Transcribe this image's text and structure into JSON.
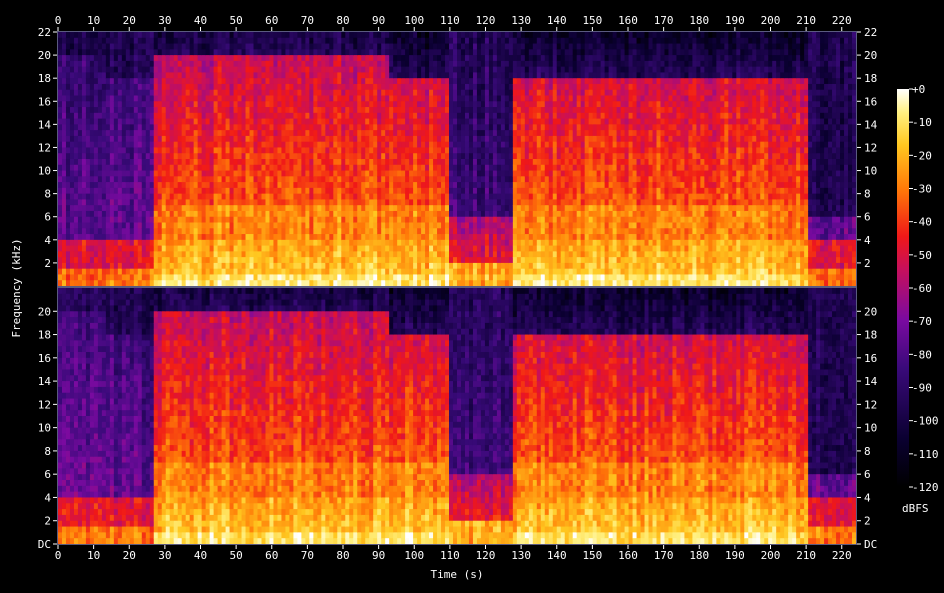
{
  "chart_data": {
    "type": "heatmap",
    "xlabel": "Time (s)",
    "ylabel": "Frequency (kHz)",
    "x_ticks": [
      "0",
      "10",
      "20",
      "30",
      "40",
      "50",
      "60",
      "70",
      "80",
      "90",
      "100",
      "110",
      "120",
      "130",
      "140",
      "150",
      "160",
      "170",
      "180",
      "190",
      "200",
      "210",
      "220"
    ],
    "xlim": [
      0,
      224
    ],
    "channels": [
      {
        "ylim": [
          0,
          22
        ],
        "y_ticks": [
          "2",
          "4",
          "6",
          "8",
          "10",
          "12",
          "14",
          "16",
          "18",
          "20",
          "22"
        ]
      },
      {
        "ylim": [
          0,
          22
        ],
        "y_ticks": [
          "DC",
          "2",
          "4",
          "6",
          "8",
          "10",
          "12",
          "14",
          "16",
          "18",
          "20"
        ]
      }
    ],
    "colorbar": {
      "label": "dBFS",
      "range": [
        -120,
        0
      ],
      "ticks": [
        "+0",
        "-10",
        "-20",
        "-30",
        "-40",
        "-50",
        "-60",
        "-70",
        "-80",
        "-90",
        "-100",
        "-110",
        "-120"
      ]
    },
    "segments": [
      {
        "t": [
          0,
          14
        ],
        "top_khz": 20,
        "level": "quiet"
      },
      {
        "t": [
          14,
          27
        ],
        "top_khz": 18,
        "level": "quiet"
      },
      {
        "t": [
          27,
          93
        ],
        "top_khz": 20,
        "level": "loud"
      },
      {
        "t": [
          93,
          110
        ],
        "top_khz": 18,
        "level": "loud"
      },
      {
        "t": [
          110,
          128
        ],
        "top_khz": 6,
        "level": "fade"
      },
      {
        "t": [
          128,
          211
        ],
        "top_khz": 18,
        "level": "loud"
      },
      {
        "t": [
          211,
          224
        ],
        "top_khz": 6,
        "level": "quiet"
      }
    ]
  }
}
